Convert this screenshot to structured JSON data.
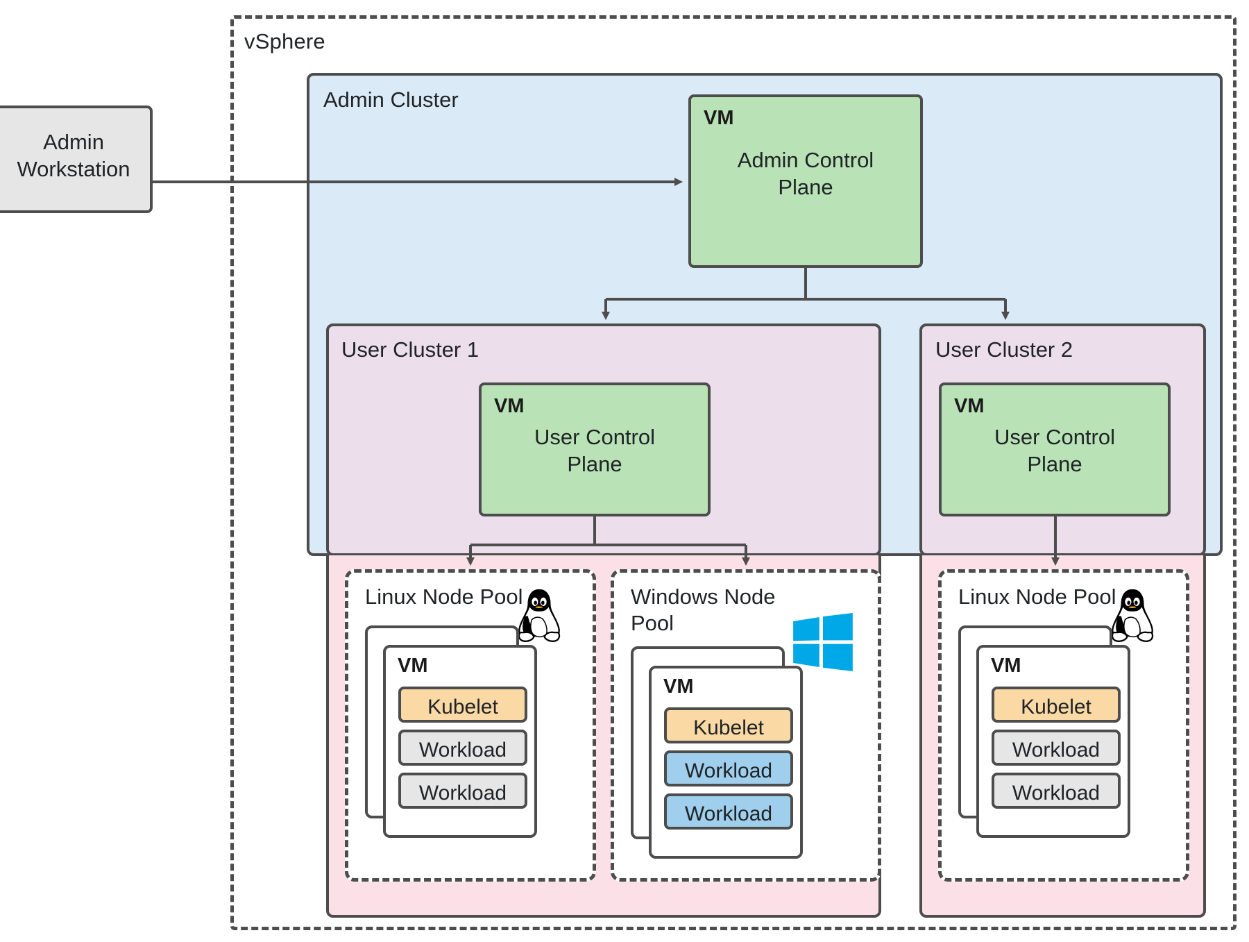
{
  "diagram": {
    "title": "vSphere",
    "boundary_label": "vSphere"
  },
  "admin_workstation": {
    "label": "Admin\nWorkstation",
    "line1": "Admin",
    "line2": "Workstation",
    "fill": "#e6e6e6"
  },
  "admin_cluster": {
    "label": "Admin Cluster",
    "fill": "#dbeaf7",
    "control_plane": {
      "vm_tag": "VM",
      "line1": "Admin Control",
      "line2": "Plane",
      "fill": "#b9e3b6"
    }
  },
  "user_clusters": [
    {
      "label": "User Cluster 1",
      "fill": "#ecdeeb",
      "control_plane": {
        "vm_tag": "VM",
        "line1": "User Control",
        "line2": "Plane",
        "fill": "#b9e3b6"
      },
      "node_pools": [
        {
          "label": "Linux Node Pool",
          "os_icon": "tux-penguin-icon",
          "vm_tag": "VM",
          "chips": [
            {
              "label": "Kubelet",
              "fill": "#fbd9a5"
            },
            {
              "label": "Workload",
              "fill": "#e6e6e6"
            },
            {
              "label": "Workload",
              "fill": "#e6e6e6"
            }
          ]
        },
        {
          "label": "Windows Node Pool",
          "os_icon": "windows-logo-icon",
          "vm_tag": "VM",
          "chips": [
            {
              "label": "Kubelet",
              "fill": "#fbd9a5"
            },
            {
              "label": "Workload",
              "fill": "#9fcfec"
            },
            {
              "label": "Workload",
              "fill": "#9fcfec"
            }
          ]
        }
      ]
    },
    {
      "label": "User Cluster 2",
      "fill": "#ecdeeb",
      "control_plane": {
        "vm_tag": "VM",
        "line1": "User Control",
        "line2": "Plane",
        "fill": "#b9e3b6"
      },
      "node_pools": [
        {
          "label": "Linux Node Pool",
          "os_icon": "tux-penguin-icon",
          "vm_tag": "VM",
          "chips": [
            {
              "label": "Kubelet",
              "fill": "#fbd9a5"
            },
            {
              "label": "Workload",
              "fill": "#e6e6e6"
            },
            {
              "label": "Workload",
              "fill": "#e6e6e6"
            }
          ]
        }
      ]
    }
  ],
  "pool_background_fill": "#fbe0e8",
  "stroke_color": "#4d4d4d",
  "connectors": [
    {
      "from": "admin-workstation",
      "to": "admin-control-plane"
    },
    {
      "from": "admin-control-plane",
      "to": "user-cluster-1"
    },
    {
      "from": "admin-control-plane",
      "to": "user-cluster-2"
    },
    {
      "from": "user-control-plane-1",
      "to": "linux-node-pool-1"
    },
    {
      "from": "user-control-plane-1",
      "to": "windows-node-pool-1"
    },
    {
      "from": "user-control-plane-2",
      "to": "linux-node-pool-2"
    }
  ]
}
